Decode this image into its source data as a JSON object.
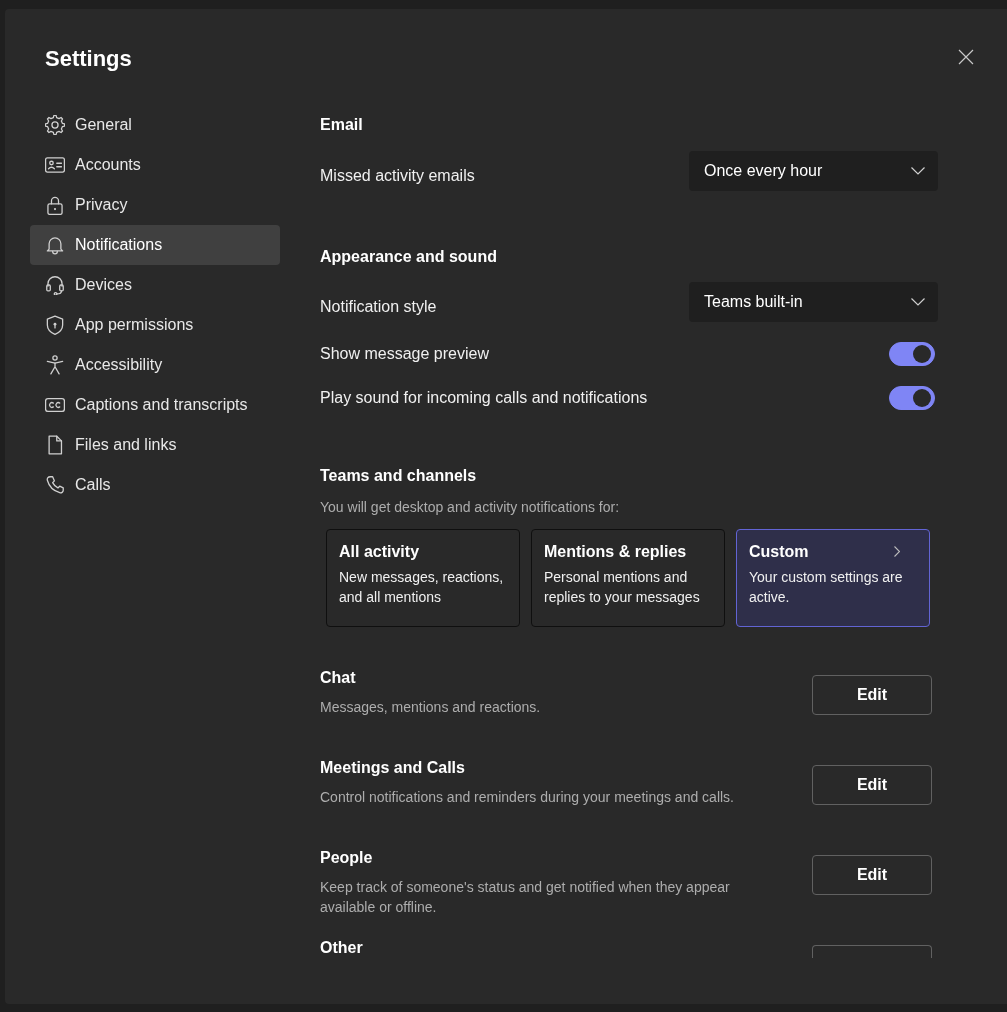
{
  "dialog": {
    "title": "Settings"
  },
  "sidebar": {
    "items": [
      {
        "label": "General",
        "selected": false
      },
      {
        "label": "Accounts",
        "selected": false
      },
      {
        "label": "Privacy",
        "selected": false
      },
      {
        "label": "Notifications",
        "selected": true
      },
      {
        "label": "Devices",
        "selected": false
      },
      {
        "label": "App permissions",
        "selected": false
      },
      {
        "label": "Accessibility",
        "selected": false
      },
      {
        "label": "Captions and transcripts",
        "selected": false
      },
      {
        "label": "Files and links",
        "selected": false
      },
      {
        "label": "Calls",
        "selected": false
      }
    ]
  },
  "settings_sections": [
    {
      "heading": "Email",
      "rows": [
        {
          "kind": "dropdown",
          "label": "Missed activity emails",
          "value": "Once every hour"
        }
      ]
    },
    {
      "heading": "Appearance and sound",
      "rows": [
        {
          "kind": "dropdown",
          "label": "Notification style",
          "value": "Teams built-in"
        },
        {
          "kind": "toggle",
          "label": "Show message preview",
          "on": true
        },
        {
          "kind": "toggle",
          "label": "Play sound for incoming calls and notifications",
          "on": true
        }
      ]
    }
  ],
  "teams_and_channels": {
    "heading": "Teams and channels",
    "subtitle": "You will get desktop and activity notifications for:",
    "options": [
      {
        "kind": "preset",
        "title": "All activity",
        "description": "New messages, reactions, and all mentions",
        "selected": false
      },
      {
        "kind": "preset",
        "title": "Mentions & replies",
        "description": "Personal mentions and replies to your messages",
        "selected": false
      },
      {
        "kind": "custom",
        "title": "Custom",
        "description": "Your custom settings are active.",
        "selected": true
      }
    ]
  },
  "categories": [
    {
      "kind": "full",
      "title": "Chat",
      "description": "Messages, mentions and reactions.",
      "button": "Edit"
    },
    {
      "kind": "full",
      "title": "Meetings and Calls",
      "description": "Control notifications and reminders during your meetings and calls.",
      "button": "Edit"
    },
    {
      "kind": "full",
      "title": "People",
      "description": "Keep track of someone's status and get notified when they appear available or offline.",
      "button": "Edit"
    },
    {
      "kind": "clipped",
      "title": "Other"
    }
  ]
}
